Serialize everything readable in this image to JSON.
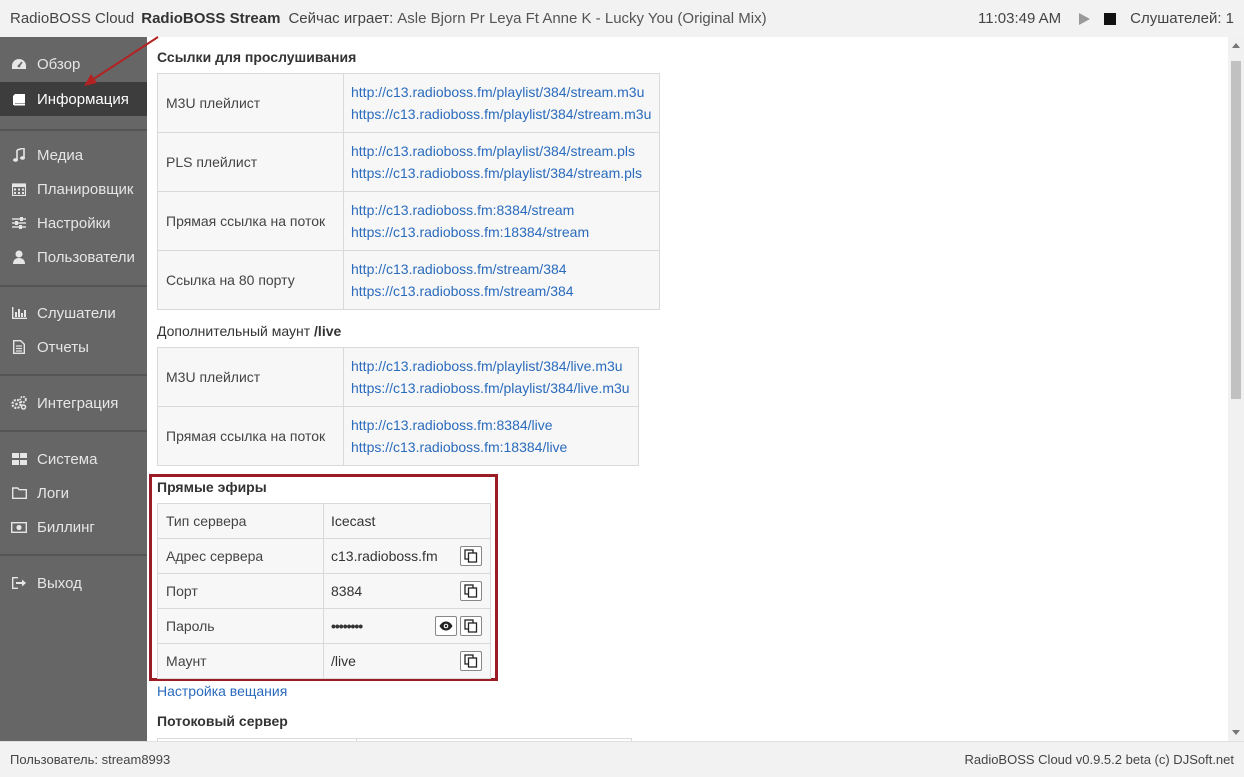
{
  "topbar": {
    "app_name": "RadioBOSS Cloud",
    "stream_name": "RadioBOSS Stream",
    "now_playing_label": "Сейчас играет:",
    "now_playing_track": "Asle Bjorn Pr Leya Ft Anne K - Lucky You (Original Mix)",
    "clock": "11:03:49 AM",
    "listeners": "Слушателей: 1"
  },
  "sidebar": {
    "items": [
      {
        "label": "Обзор",
        "icon": "dashboard-icon"
      },
      {
        "label": "Информация",
        "icon": "book-icon"
      },
      {
        "label": "Медиа",
        "icon": "music-icon"
      },
      {
        "label": "Планировщик",
        "icon": "calendar-icon"
      },
      {
        "label": "Настройки",
        "icon": "sliders-icon"
      },
      {
        "label": "Пользователи",
        "icon": "user-icon"
      },
      {
        "label": "Слушатели",
        "icon": "bar-chart-icon"
      },
      {
        "label": "Отчеты",
        "icon": "document-icon"
      },
      {
        "label": "Интеграция",
        "icon": "gears-icon"
      },
      {
        "label": "Система",
        "icon": "grid-icon"
      },
      {
        "label": "Логи",
        "icon": "folder-icon"
      },
      {
        "label": "Биллинг",
        "icon": "money-icon"
      },
      {
        "label": "Выход",
        "icon": "sign-out-icon"
      }
    ],
    "active": "Информация"
  },
  "main": {
    "listen_links_title": "Ссылки для прослушивания",
    "listen_links": [
      {
        "label": "M3U плейлист",
        "urls": [
          "http://c13.radioboss.fm/playlist/384/stream.m3u",
          "https://c13.radioboss.fm/playlist/384/stream.m3u"
        ]
      },
      {
        "label": "PLS плейлист",
        "urls": [
          "http://c13.radioboss.fm/playlist/384/stream.pls",
          "https://c13.radioboss.fm/playlist/384/stream.pls"
        ]
      },
      {
        "label": "Прямая ссылка на поток",
        "urls": [
          "http://c13.radioboss.fm:8384/stream",
          "https://c13.radioboss.fm:18384/stream"
        ]
      },
      {
        "label": "Ссылка на 80 порту",
        "urls": [
          "http://c13.radioboss.fm/stream/384",
          "https://c13.radioboss.fm/stream/384"
        ]
      }
    ],
    "extra_mount_label": "Дополнительный маунт",
    "extra_mount_name": "/live",
    "live_links": [
      {
        "label": "M3U плейлист",
        "urls": [
          "http://c13.radioboss.fm/playlist/384/live.m3u",
          "https://c13.radioboss.fm/playlist/384/live.m3u"
        ]
      },
      {
        "label": "Прямая ссылка на поток",
        "urls": [
          "http://c13.radioboss.fm:8384/live",
          "https://c13.radioboss.fm:18384/live"
        ]
      }
    ],
    "live_title": "Прямые эфиры",
    "live_info": {
      "server_type_label": "Тип сервера",
      "server_type": "Icecast",
      "server_address_label": "Адрес сервера",
      "server_address": "c13.radioboss.fm",
      "port_label": "Порт",
      "port": "8384",
      "password_label": "Пароль",
      "password": "••••••••",
      "mount_label": "Маунт",
      "mount": "/live"
    },
    "broadcast_settings_link": "Настройка вещания",
    "stream_server_title": "Потоковый сервер"
  },
  "footer": {
    "user": "Пользователь: stream8993",
    "version": "RadioBOSS Cloud v0.9.5.2 beta (c) DJSoft.net"
  },
  "colors": {
    "sidebar_bg": "#666666",
    "sidebar_active": "#3d3d3d",
    "link": "#2a6bbd",
    "highlight_border": "#9b1c24",
    "annotation_arrow": "#b22222"
  }
}
